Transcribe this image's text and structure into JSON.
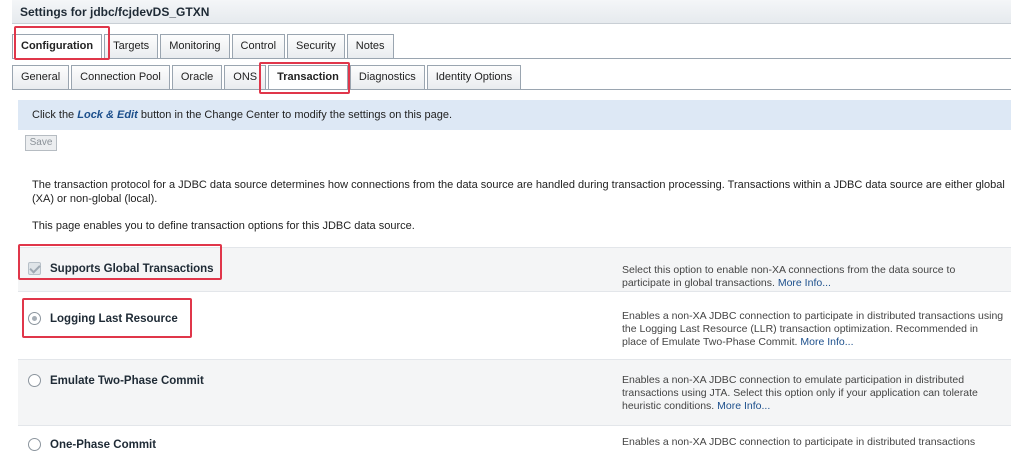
{
  "window_title": "Settings for jdbc/fcjdevDS_GTXN",
  "primary_tabs": [
    {
      "label": "Configuration",
      "active": true
    },
    {
      "label": "Targets"
    },
    {
      "label": "Monitoring"
    },
    {
      "label": "Control"
    },
    {
      "label": "Security"
    },
    {
      "label": "Notes"
    }
  ],
  "secondary_tabs": [
    {
      "label": "General"
    },
    {
      "label": "Connection Pool"
    },
    {
      "label": "Oracle"
    },
    {
      "label": "ONS"
    },
    {
      "label": "Transaction",
      "active": true
    },
    {
      "label": "Diagnostics"
    },
    {
      "label": "Identity Options"
    }
  ],
  "info_bar": {
    "prefix": "Click the",
    "emphasis": "Lock & Edit",
    "suffix": "button in the Change Center to modify the settings on this page."
  },
  "save_label": "Save",
  "intro_text": "The transaction protocol for a JDBC data source determines how connections from the data source are handled during transaction processing. Transactions within a JDBC data source are either global (XA) or non-global (local).",
  "intro_text2": "This page enables you to define transaction options for this JDBC data source.",
  "options": [
    {
      "label": "Supports Global Transactions",
      "control": "checkbox",
      "checked": true,
      "description": "Select this option to enable non-XA connections from the data source to participate in global transactions.",
      "more_info": "More Info..."
    },
    {
      "label": "Logging Last Resource",
      "control": "radio",
      "checked": true,
      "description": "Enables a non-XA JDBC connection to participate in distributed transactions using the Logging Last Resource (LLR) transaction optimization. Recommended in place of Emulate Two-Phase Commit.",
      "more_info": "More Info..."
    },
    {
      "label": "Emulate Two-Phase Commit",
      "control": "radio",
      "checked": false,
      "description": "Enables a non-XA JDBC connection to emulate participation in distributed transactions using JTA. Select this option only if your application can tolerate heuristic conditions.",
      "more_info": "More Info..."
    },
    {
      "label": "One-Phase Commit",
      "control": "radio",
      "checked": false,
      "description": "Enables a non-XA JDBC connection to participate in distributed transactions"
    }
  ],
  "colors": {
    "highlight": "#e0364a",
    "info_background": "#dde8f5",
    "link": "#1c4f8c"
  }
}
